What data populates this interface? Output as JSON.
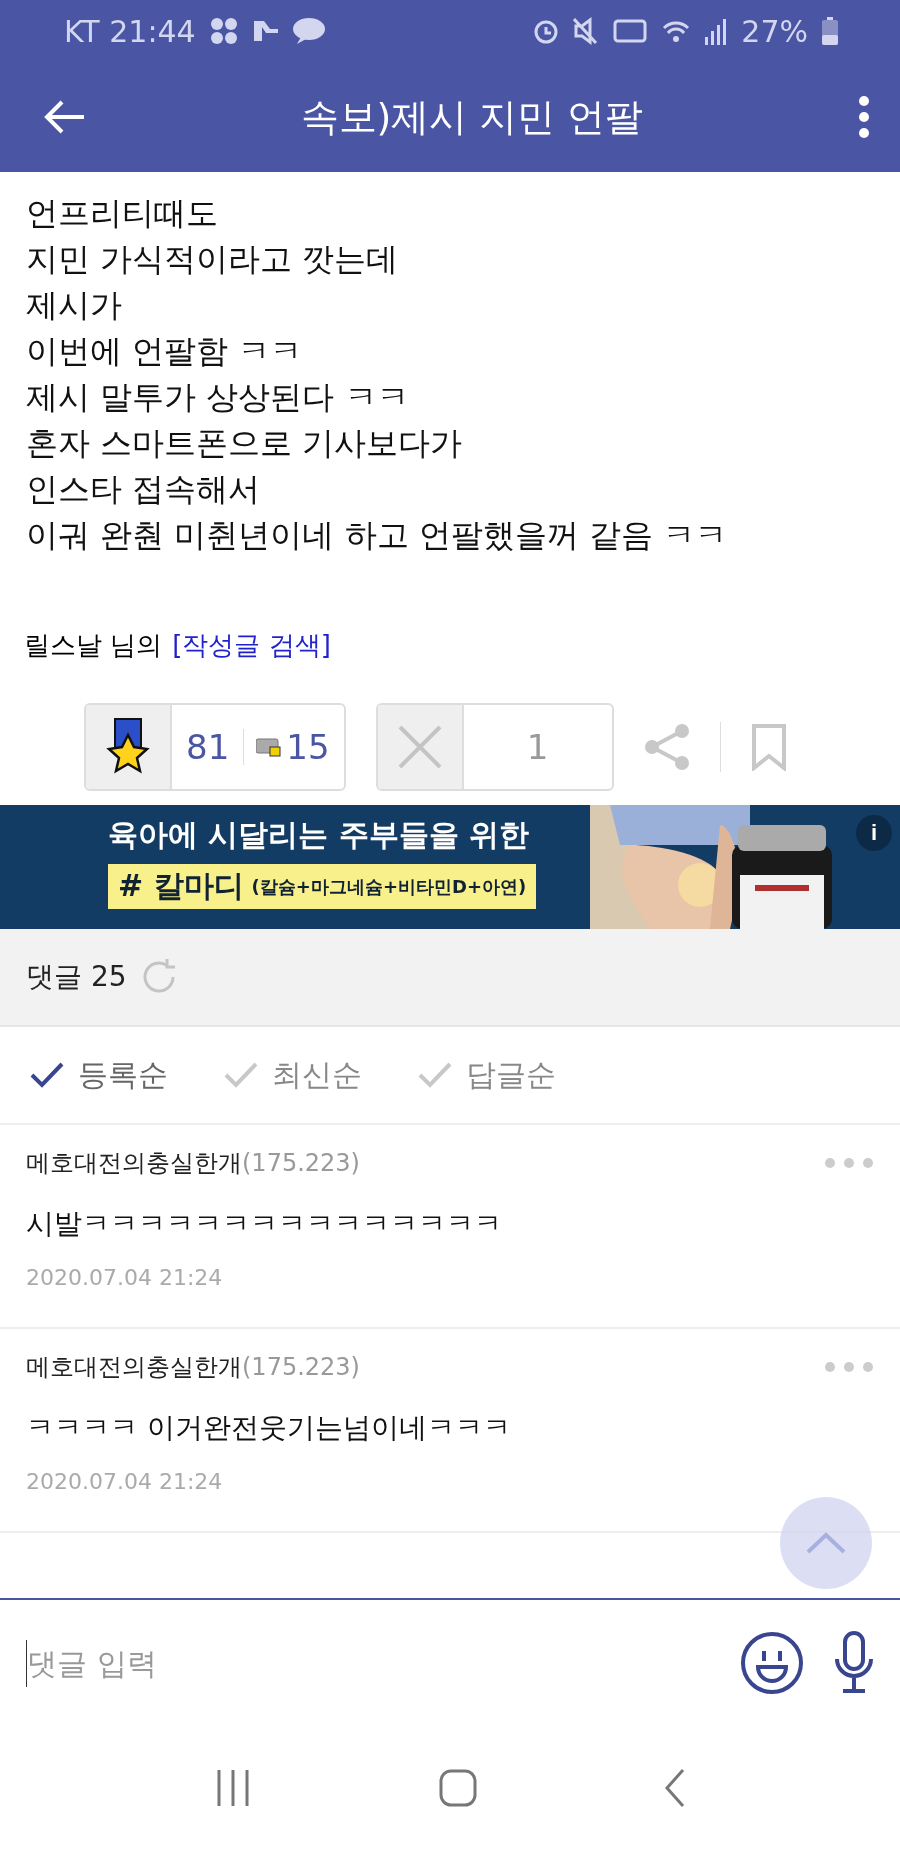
{
  "status_bar": {
    "carrier_time": "KT 21:44",
    "battery": "27%"
  },
  "header": {
    "title": "속보)제시 지민 언팔"
  },
  "post": {
    "lines": [
      "언프리티때도",
      "지민 가식적이라고 깟는데",
      "제시가",
      "이번에 언팔함 ㅋㅋ",
      "제시 말투가 상상된다 ㅋㅋ",
      "혼자 스마트폰으로 기사보다가",
      "인스타 접속해서",
      "이궈 완춴 미췬년이네 하고 언팔했을꺼 같음 ㅋㅋ"
    ],
    "author": "릴스날 님의",
    "author_link": "[작성글 검색]",
    "likes": "81",
    "like_extra": "15",
    "dislikes": "1"
  },
  "ad": {
    "headline": "육아에 시달리는 주부들을 위한",
    "tag": "# 칼마디",
    "tag_detail": "(칼슘+마그네슘+비타민D+아연)",
    "info": "i"
  },
  "comments_header": {
    "label": "댓글 25"
  },
  "sort_options": [
    {
      "label": "등록순",
      "selected": true
    },
    {
      "label": "최신순",
      "selected": false
    },
    {
      "label": "답글순",
      "selected": false
    }
  ],
  "comments": [
    {
      "author": "메호대전의충실한개",
      "ip": "(175.223)",
      "body": "시발ㅋㅋㅋㅋㅋㅋㅋㅋㅋㅋㅋㅋㅋㅋㅋ",
      "date": "2020.07.04 21:24"
    },
    {
      "author": "메호대전의충실한개",
      "ip": "(175.223)",
      "body": "ㅋㅋㅋㅋ 이거완전웃기는넘이네ㅋㅋㅋ",
      "date": "2020.07.04 21:24"
    }
  ],
  "comment_input": {
    "placeholder": "댓글 입력"
  }
}
